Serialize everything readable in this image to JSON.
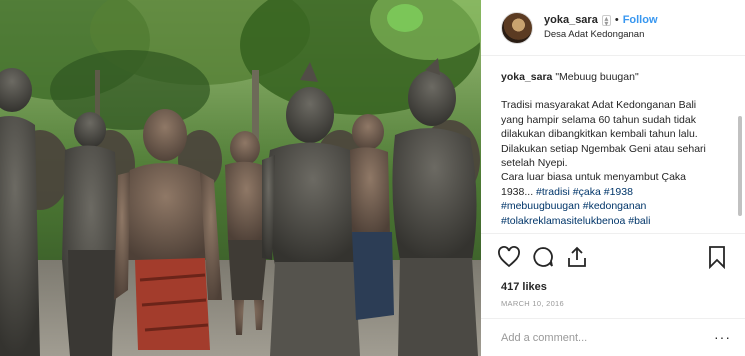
{
  "post": {
    "username": "yoka_sara",
    "follow_label": "Follow",
    "dot": "•",
    "location": "Desa Adat Kedonganan"
  },
  "caption": {
    "username": "yoka_sara",
    "title": "\"Mebuug buugan\"",
    "lines": [
      "Tradisi masyarakat Adat Kedonganan Bali",
      "yang hampir selama 60 tahun sudah tidak",
      "dilakukan dibangkitkan kembali tahun lalu.",
      "Dilakukan setiap Ngembak Geni atau sehari",
      "setelah Nyepi.",
      "Cara luar biasa untuk menyambut Çaka"
    ],
    "last_line_prefix": "1938... ",
    "tags_line1": "#tradisi #çaka #1938",
    "tags_line2": "#mebuugbuugan #kedonganan",
    "tags_line3": "#tolakreklamasitelukbenoa #bali"
  },
  "actions": {
    "like_icon": "heart-icon",
    "comment_icon": "comment-icon",
    "share_icon": "share-icon",
    "save_icon": "bookmark-icon"
  },
  "likes": "417 likes",
  "date": "MARCH 10, 2016",
  "comment_input": {
    "placeholder": "Add a comment...",
    "more": "···"
  },
  "colors": {
    "link": "#3897f0",
    "hashtag": "#003569",
    "muted": "#999999",
    "text": "#262626"
  }
}
